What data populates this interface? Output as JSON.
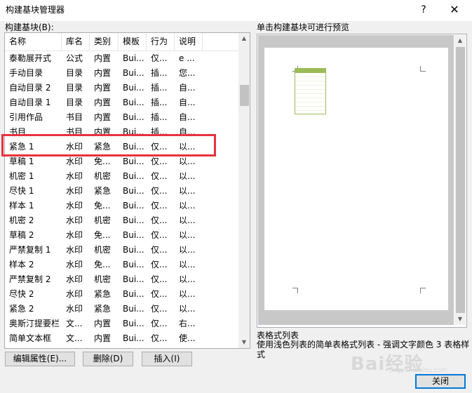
{
  "window": {
    "title": "构建基块管理器",
    "help": "?",
    "close": "✕"
  },
  "list": {
    "label": "构建基块(B):",
    "columns": [
      "名称",
      "库名",
      "类别",
      "模板",
      "行为",
      "说明"
    ],
    "rows": [
      [
        "泰勒展开式",
        "公式",
        "内置",
        "Bui...",
        "仅...",
        "e ..."
      ],
      [
        "手动目录",
        "目录",
        "内置",
        "Bui...",
        "插...",
        "您..."
      ],
      [
        "自动目录 2",
        "目录",
        "内置",
        "Bui...",
        "插...",
        "自..."
      ],
      [
        "自动目录 1",
        "目录",
        "内置",
        "Bui...",
        "插...",
        "自..."
      ],
      [
        "引用作品",
        "书目",
        "内置",
        "Bui...",
        "插...",
        "自..."
      ],
      [
        "书目",
        "书目",
        "内置",
        "Bui...",
        "插...",
        "自..."
      ],
      [
        "紧急 1",
        "水印",
        "紧急",
        "Bui...",
        "仅...",
        "以..."
      ],
      [
        "草稿 1",
        "水印",
        "免...",
        "Bui...",
        "仅...",
        "以..."
      ],
      [
        "机密 1",
        "水印",
        "机密",
        "Bui...",
        "仅...",
        "以..."
      ],
      [
        "尽快 1",
        "水印",
        "紧急",
        "Bui...",
        "仅...",
        "以..."
      ],
      [
        "样本 1",
        "水印",
        "免...",
        "Bui...",
        "仅...",
        "以..."
      ],
      [
        "机密 2",
        "水印",
        "机密",
        "Bui...",
        "仅...",
        "以..."
      ],
      [
        "草稿 2",
        "水印",
        "免...",
        "Bui...",
        "仅...",
        "以..."
      ],
      [
        "严禁复制 1",
        "水印",
        "机密",
        "Bui...",
        "仅...",
        "以..."
      ],
      [
        "样本 2",
        "水印",
        "免...",
        "Bui...",
        "仅...",
        "以..."
      ],
      [
        "严禁复制 2",
        "水印",
        "机密",
        "Bui...",
        "仅...",
        "以..."
      ],
      [
        "尽快 2",
        "水印",
        "紧急",
        "Bui...",
        "仅...",
        "以..."
      ],
      [
        "紧急 2",
        "水印",
        "紧急",
        "Bui...",
        "仅...",
        "以..."
      ],
      [
        "奥斯汀提要栏",
        "文...",
        "内置",
        "Bui...",
        "仅...",
        "右..."
      ],
      [
        "简单文本框",
        "文...",
        "内置",
        "Bui...",
        "仅...",
        "使..."
      ]
    ]
  },
  "buttons": {
    "edit": "编辑属性(E)...",
    "delete": "删除(D)",
    "insert": "插入(I)",
    "close": "关闭"
  },
  "preview": {
    "label": "单击构建基块可进行预览",
    "description_title": "表格式列表",
    "description": "使用浅色列表的简单表格式列表 - 强调文字颜色 3 表格样式",
    "accent_color": "#9bbb59"
  },
  "watermark": {
    "text": "Bai经验",
    "url": "jingyan.baidu.com"
  }
}
